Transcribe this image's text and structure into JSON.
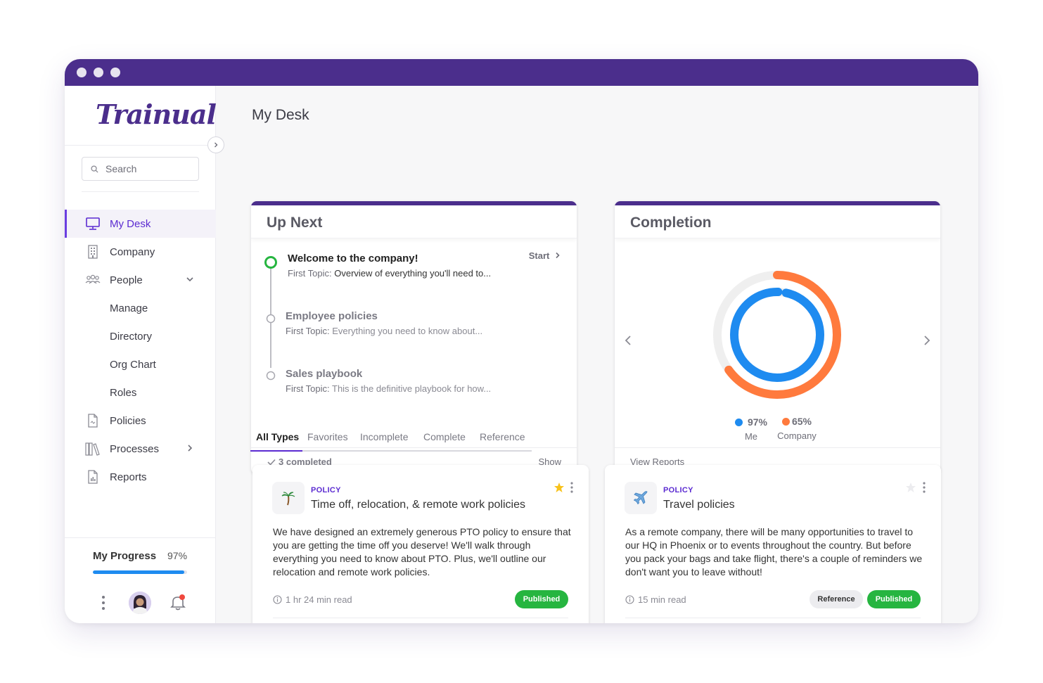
{
  "app": {
    "logo_text": "Trainual"
  },
  "sidebar": {
    "search_placeholder": "Search",
    "items": [
      {
        "label": "My Desk"
      },
      {
        "label": "Company"
      },
      {
        "label": "People"
      },
      {
        "label": "Manage"
      },
      {
        "label": "Directory"
      },
      {
        "label": "Org Chart"
      },
      {
        "label": "Roles"
      },
      {
        "label": "Policies"
      },
      {
        "label": "Processes"
      },
      {
        "label": "Reports"
      }
    ],
    "progress": {
      "title": "My Progress",
      "percent_label": "97%",
      "fraction": 0.97
    }
  },
  "main": {
    "title": "My Desk"
  },
  "up_next": {
    "title": "Up Next",
    "start_label": "Start",
    "items": [
      {
        "title": "Welcome to the company!",
        "topic_label": "First Topic:",
        "topic": "Overview of everything you'll need to..."
      },
      {
        "title": "Employee policies",
        "topic_label": "First Topic:",
        "topic": "Everything you need to know about..."
      },
      {
        "title": "Sales playbook",
        "topic_label": "First Topic:",
        "topic": "This is the definitive playbook for how..."
      }
    ],
    "completed_label": "3 completed",
    "show_label": "Show"
  },
  "completion": {
    "title": "Completion",
    "me_percent": "97%",
    "me_label": "Me",
    "company_percent": "65%",
    "company_label": "Company",
    "me_fraction": 0.97,
    "company_fraction": 0.65,
    "view_reports_label": "View Reports",
    "colors": {
      "me": "#1e8bf0",
      "company": "#ff7a3d",
      "track": "#efefef"
    }
  },
  "tabs": [
    {
      "label": "All Types"
    },
    {
      "label": "Favorites"
    },
    {
      "label": "Incomplete"
    },
    {
      "label": "Complete"
    },
    {
      "label": "Reference"
    }
  ],
  "documents": [
    {
      "type": "POLICY",
      "title": "Time off, relocation, & remote work policies",
      "description": "We have designed an extremely generous PTO policy to ensure that you are getting the time off you deserve! We'll walk through everything you need to know about PTO. Plus, we'll outline our relocation and remote work policies.",
      "read_time": "1 hr 24 min read",
      "badges": [
        "Published"
      ],
      "favorite": true
    },
    {
      "type": "POLICY",
      "title": "Travel policies",
      "description": "As a remote company, there will be many opportunities to travel to our HQ in Phoenix or to events throughout the country. But before you pack your bags and take flight, there's a couple of reminders we don't want you to leave without!",
      "read_time": "15 min read",
      "badges": [
        "Reference",
        "Published"
      ],
      "favorite": false
    }
  ]
}
